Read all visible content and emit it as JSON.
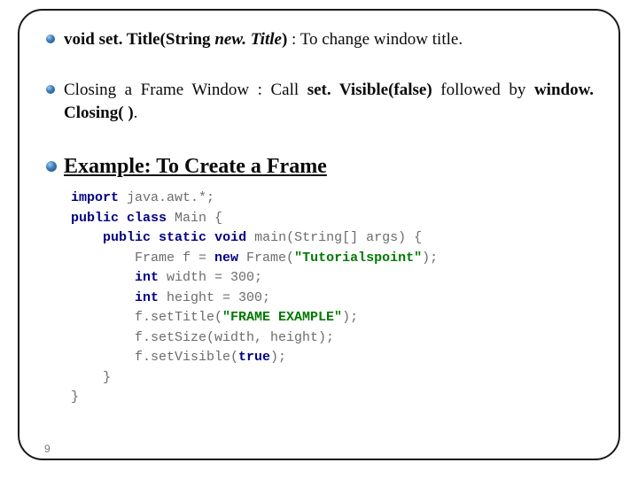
{
  "bullets": {
    "setTitle": {
      "prefix_bold": "void set. Title(String ",
      "param_italic_bold": "new. Title",
      "suffix_bold": ")",
      "desc": " : To change window title."
    },
    "closing": {
      "part1": "Closing  a  Frame  Window  :  Call  ",
      "bold1": "set. Visible(false)",
      "part2": "  followed  by ",
      "bold2": "window. Closing( )",
      "part3": "."
    },
    "example_heading": "Example: To Create a Frame"
  },
  "code": {
    "l1_kw": "import",
    "l1_rest": " java.awt.*;",
    "l2_kw1": "public",
    "l2_kw2": "class",
    "l2_rest": " Main {",
    "l3_pad": "    ",
    "l3_kw1": "public",
    "l3_kw2": "static",
    "l3_kw3": "void",
    "l3_rest": " main(String[] args) {",
    "l4_pad": "        Frame f = ",
    "l4_kw": "new",
    "l4_mid": " Frame(",
    "l4_str": "\"Tutorialspoint\"",
    "l4_end": ");",
    "l5_pad": "        ",
    "l5_kw": "int",
    "l5_rest": " width = 300;",
    "l6_pad": "        ",
    "l6_kw": "int",
    "l6_rest": " height = 300;",
    "l7_pad": "        f.setTitle(",
    "l7_str": "\"FRAME EXAMPLE\"",
    "l7_end": ");",
    "l8": "        f.setSize(width, height);",
    "l9_pad": "        f.setVisible(",
    "l9_kw": "true",
    "l9_end": ");",
    "l10": "    }",
    "l11": "}"
  },
  "page_number": "9"
}
